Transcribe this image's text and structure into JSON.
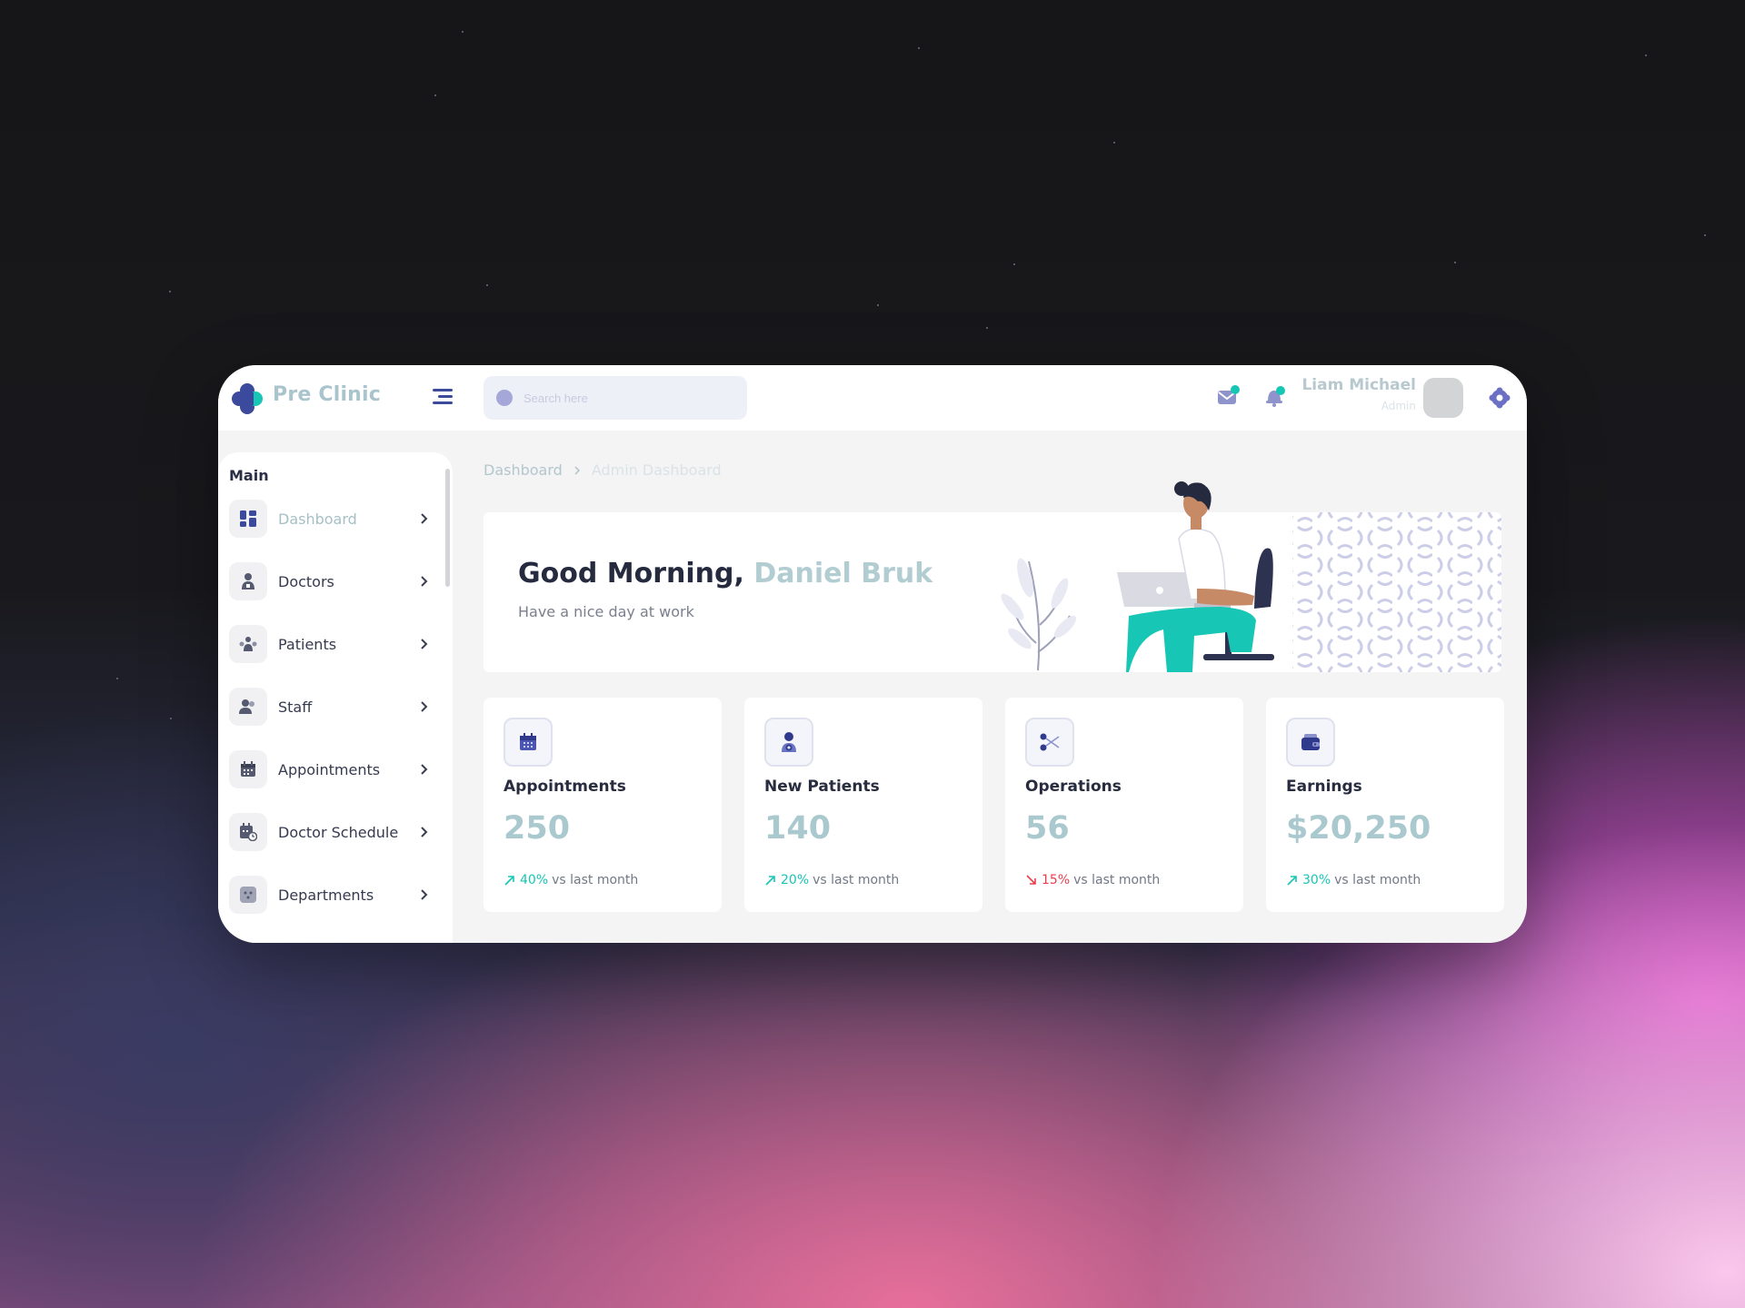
{
  "app": {
    "brand": "Pre Clinic",
    "colors": {
      "accent": "#3b4a9c",
      "teal": "#17c6b5",
      "red": "#e6404f"
    }
  },
  "header": {
    "search_placeholder": "Search here",
    "user_name": "Liam Michael",
    "user_role": "Admin",
    "icons": [
      "mail-icon",
      "bell-icon",
      "settings-icon"
    ]
  },
  "sidebar": {
    "section": "Main",
    "items": [
      {
        "label": "Dashboard",
        "icon": "dashboard-icon",
        "active": true
      },
      {
        "label": "Doctors",
        "icon": "doctor-icon"
      },
      {
        "label": "Patients",
        "icon": "patients-icon"
      },
      {
        "label": "Staff",
        "icon": "staff-icon"
      },
      {
        "label": "Appointments",
        "icon": "calendar-icon"
      },
      {
        "label": "Doctor Schedule",
        "icon": "schedule-icon"
      },
      {
        "label": "Departments",
        "icon": "departments-icon"
      }
    ]
  },
  "breadcrumb": {
    "parent": "Dashboard",
    "current": "Admin Dashboard"
  },
  "hero": {
    "greeting": "Good Morning,",
    "name": "Daniel Bruk",
    "subtitle": "Have a nice day at work"
  },
  "stats": [
    {
      "title": "Appointments",
      "value": "250",
      "percent": "40%",
      "direction": "up",
      "suffix": "vs last month",
      "icon": "calendar-icon"
    },
    {
      "title": "New Patients",
      "value": "140",
      "percent": "20%",
      "direction": "up",
      "suffix": "vs last month",
      "icon": "new-patient-icon"
    },
    {
      "title": "Operations",
      "value": "56",
      "percent": "15%",
      "direction": "down",
      "suffix": "vs last month",
      "icon": "scissors-icon"
    },
    {
      "title": "Earnings",
      "value": "$20,250",
      "percent": "30%",
      "direction": "up",
      "suffix": "vs last month",
      "icon": "wallet-icon"
    }
  ]
}
